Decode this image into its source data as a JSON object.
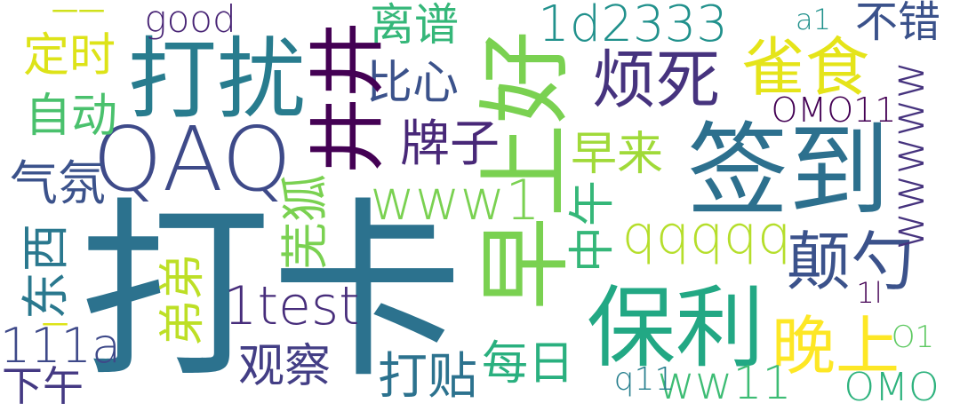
{
  "words": [
    {
      "text": "打卡",
      "color": "#2c728e"
    },
    {
      "text": "打扰",
      "color": "#287c8e"
    },
    {
      "text": "QAQ",
      "color": "#3e4a89"
    },
    {
      "text": "签到",
      "color": "#2d708e"
    },
    {
      "text": "保利",
      "color": "#22a884"
    },
    {
      "text": "烦死",
      "color": "#46337e"
    },
    {
      "text": "雀食",
      "color": "#e5e419"
    },
    {
      "text": "1d2333",
      "color": "#21918c"
    },
    {
      "text": "不错",
      "color": "#3b528b"
    },
    {
      "text": "a1",
      "color": "#21918c"
    },
    {
      "text": "离谱",
      "color": "#35b779"
    },
    {
      "text": "good",
      "color": "#482475"
    },
    {
      "text": "一一",
      "color": "#d0e11c"
    },
    {
      "text": "定时",
      "color": "#dde318"
    },
    {
      "text": "自动",
      "color": "#4ac16d"
    },
    {
      "text": "气氛",
      "color": "#3b528b"
    },
    {
      "text": "比心",
      "color": "#3b528b"
    },
    {
      "text": "牌子",
      "color": "#482878"
    },
    {
      "text": "早来",
      "color": "#a0da39"
    },
    {
      "text": "www1",
      "color": "#7ad151"
    },
    {
      "text": "qqqqq",
      "color": "#b5de2b"
    },
    {
      "text": "颠勺",
      "color": "#3b528b"
    },
    {
      "text": "1test",
      "color": "#472d7b"
    },
    {
      "text": "111a",
      "color": "#3e4989"
    },
    {
      "text": "下午",
      "color": "#443983"
    },
    {
      "text": "观察",
      "color": "#433e85"
    },
    {
      "text": "打贴",
      "color": "#2c728e"
    },
    {
      "text": "每日",
      "color": "#2ab07f"
    },
    {
      "text": "晚上",
      "color": "#fde725"
    },
    {
      "text": "OMO11",
      "color": "#440154"
    },
    {
      "text": "O1",
      "color": "#5ec962"
    },
    {
      "text": "OMO",
      "color": "#2db27d"
    },
    {
      "text": "ww11",
      "color": "#3dbc74"
    },
    {
      "text": "q11",
      "color": "#277f8e"
    },
    {
      "text": "1l",
      "color": "#440154"
    },
    {
      "text": "早上好",
      "color": "#7ad151"
    },
    {
      "text": "井井",
      "color": "#440154"
    },
    {
      "text": "芜狐",
      "color": "#7ad151"
    },
    {
      "text": "东西",
      "color": "#2a788e"
    },
    {
      "text": "弟弟",
      "color": "#bddf26"
    },
    {
      "text": "中午",
      "color": "#35b779"
    },
    {
      "text": "wwwww",
      "color": "#46337e"
    },
    {
      "text": "一",
      "color": "#dde318"
    }
  ]
}
